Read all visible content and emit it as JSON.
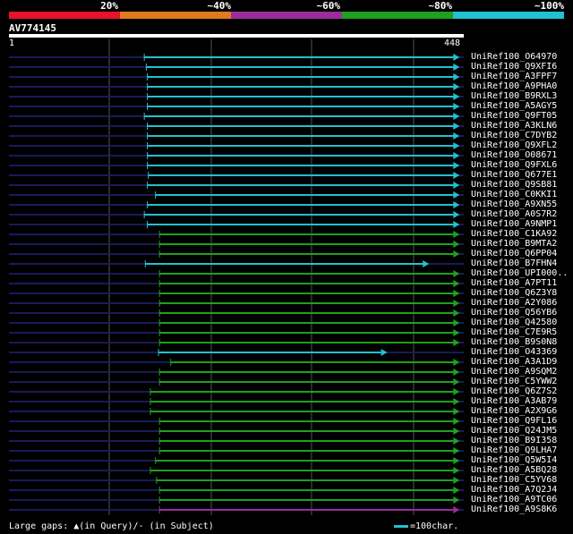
{
  "legend": {
    "labels": [
      "20%",
      "~40%",
      "~60%",
      "~80%",
      "~100%"
    ],
    "colors": [
      "#e8122a",
      "#e07a1e",
      "#9b2d9b",
      "#1fa01f",
      "#22c0d0"
    ]
  },
  "query": {
    "id": "AV774145",
    "start": "1",
    "end": "448"
  },
  "hits": [
    {
      "name": "UniRef100_O64970",
      "start": 134,
      "end": 443,
      "color": "cyan"
    },
    {
      "name": "UniRef100_Q9XFI6",
      "start": 136,
      "end": 443,
      "color": "cyan"
    },
    {
      "name": "UniRef100_A3FPF7",
      "start": 137,
      "end": 443,
      "color": "cyan"
    },
    {
      "name": "UniRef100_A9PHA0",
      "start": 137,
      "end": 443,
      "color": "cyan"
    },
    {
      "name": "UniRef100_B9RXL3",
      "start": 137,
      "end": 443,
      "color": "cyan"
    },
    {
      "name": "UniRef100_A5AGY5",
      "start": 137,
      "end": 443,
      "color": "cyan"
    },
    {
      "name": "UniRef100_Q9FT05",
      "start": 134,
      "end": 443,
      "color": "cyan"
    },
    {
      "name": "UniRef100_A3KLN6",
      "start": 137,
      "end": 443,
      "color": "cyan"
    },
    {
      "name": "UniRef100_C7DYB2",
      "start": 137,
      "end": 443,
      "color": "cyan"
    },
    {
      "name": "UniRef100_Q9XFL2",
      "start": 137,
      "end": 443,
      "color": "cyan"
    },
    {
      "name": "UniRef100_O08671",
      "start": 137,
      "end": 443,
      "color": "cyan"
    },
    {
      "name": "UniRef100_Q9FXL6",
      "start": 137,
      "end": 443,
      "color": "cyan"
    },
    {
      "name": "UniRef100_Q677E1",
      "start": 138,
      "end": 443,
      "color": "cyan"
    },
    {
      "name": "UniRef100_Q9SB81",
      "start": 137,
      "end": 443,
      "color": "cyan"
    },
    {
      "name": "UniRef100_C0KKI1",
      "start": 145,
      "end": 443,
      "color": "cyan"
    },
    {
      "name": "UniRef100_A9XN55",
      "start": 137,
      "end": 443,
      "color": "cyan"
    },
    {
      "name": "UniRef100_A0S7R2",
      "start": 134,
      "end": 443,
      "color": "cyan"
    },
    {
      "name": "UniRef100_A9NMP1",
      "start": 137,
      "end": 443,
      "color": "cyan"
    },
    {
      "name": "UniRef100_C1KA92",
      "start": 149,
      "end": 443,
      "color": "green"
    },
    {
      "name": "UniRef100_B9MTA2",
      "start": 149,
      "end": 443,
      "color": "green"
    },
    {
      "name": "UniRef100_Q6PP04",
      "start": 149,
      "end": 443,
      "color": "green"
    },
    {
      "name": "UniRef100_B7FHN4",
      "start": 135,
      "end": 413,
      "color": "cyan"
    },
    {
      "name": "UniRef100_UPI000..",
      "start": 149,
      "end": 443,
      "color": "green"
    },
    {
      "name": "UniRef100_A7PT11",
      "start": 149,
      "end": 443,
      "color": "green"
    },
    {
      "name": "UniRef100_Q6Z3Y8",
      "start": 149,
      "end": 443,
      "color": "green"
    },
    {
      "name": "UniRef100_A2Y086",
      "start": 149,
      "end": 443,
      "color": "green"
    },
    {
      "name": "UniRef100_Q56YB6",
      "start": 149,
      "end": 443,
      "color": "green"
    },
    {
      "name": "UniRef100_Q42580",
      "start": 149,
      "end": 443,
      "color": "green"
    },
    {
      "name": "UniRef100_C7E9R5",
      "start": 149,
      "end": 443,
      "color": "green"
    },
    {
      "name": "UniRef100_B9S0N8",
      "start": 149,
      "end": 443,
      "color": "green"
    },
    {
      "name": "UniRef100_O43369",
      "start": 148,
      "end": 372,
      "color": "cyan"
    },
    {
      "name": "UniRef100_A3A1D9",
      "start": 160,
      "end": 443,
      "color": "green"
    },
    {
      "name": "UniRef100_A9SQM2",
      "start": 149,
      "end": 443,
      "color": "green"
    },
    {
      "name": "UniRef100_C5YWW2",
      "start": 149,
      "end": 443,
      "color": "green"
    },
    {
      "name": "UniRef100_Q6Z7S2",
      "start": 140,
      "end": 443,
      "color": "green"
    },
    {
      "name": "UniRef100_A3AB79",
      "start": 140,
      "end": 443,
      "color": "green"
    },
    {
      "name": "UniRef100_A2X9G6",
      "start": 140,
      "end": 443,
      "color": "green"
    },
    {
      "name": "UniRef100_Q9FL16",
      "start": 149,
      "end": 443,
      "color": "green"
    },
    {
      "name": "UniRef100_Q24JM5",
      "start": 149,
      "end": 443,
      "color": "green"
    },
    {
      "name": "UniRef100_B9I358",
      "start": 149,
      "end": 443,
      "color": "green"
    },
    {
      "name": "UniRef100_Q9LHA7",
      "start": 149,
      "end": 443,
      "color": "green"
    },
    {
      "name": "UniRef100_Q5W5I4",
      "start": 145,
      "end": 443,
      "color": "green"
    },
    {
      "name": "UniRef100_A5BQ28",
      "start": 140,
      "end": 443,
      "color": "green"
    },
    {
      "name": "UniRef100_C5YV68",
      "start": 146,
      "end": 443,
      "color": "green"
    },
    {
      "name": "UniRef100_A7Q2J4",
      "start": 149,
      "end": 443,
      "color": "green"
    },
    {
      "name": "UniRef100_A9TC06",
      "start": 149,
      "end": 443,
      "color": "green"
    },
    {
      "name": "UniRef100_A9S8K6",
      "start": 149,
      "end": 443,
      "color": "purple"
    }
  ],
  "hit_colors": {
    "cyan": "#22c0d0",
    "green": "#1fa01f",
    "purple": "#9b2d9b",
    "dark": "#1a1a5a"
  },
  "footer": {
    "gap_legend": "Large gaps: ▲(in Query)/- (in Subject)",
    "scale_legend": "=100char."
  }
}
